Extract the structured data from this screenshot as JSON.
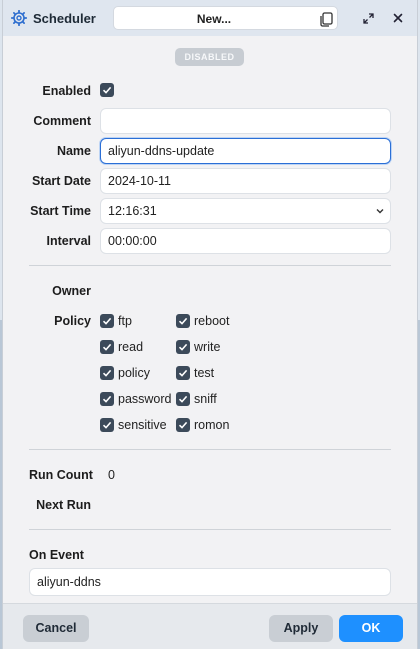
{
  "titlebar": {
    "title": "Scheduler",
    "field_value": "New...",
    "gear_icon": "gear-icon",
    "copy_icon": "copy-icon",
    "expand_icon": "expand-icon",
    "close_icon": "close-icon"
  },
  "status_badge": "DISABLED",
  "form": {
    "enabled_label": "Enabled",
    "enabled_checked": true,
    "comment_label": "Comment",
    "comment_value": "",
    "name_label": "Name",
    "name_value": "aliyun-ddns-update",
    "start_date_label": "Start Date",
    "start_date_value": "2024-10-11",
    "start_time_label": "Start Time",
    "start_time_value": "12:16:31",
    "interval_label": "Interval",
    "interval_value": "00:00:00"
  },
  "owner": {
    "label": "Owner",
    "value": ""
  },
  "policy": {
    "label": "Policy",
    "items": [
      {
        "label": "ftp",
        "checked": true
      },
      {
        "label": "reboot",
        "checked": true
      },
      {
        "label": "read",
        "checked": true
      },
      {
        "label": "write",
        "checked": true
      },
      {
        "label": "policy",
        "checked": true
      },
      {
        "label": "test",
        "checked": true
      },
      {
        "label": "password",
        "checked": true
      },
      {
        "label": "sniff",
        "checked": true
      },
      {
        "label": "sensitive",
        "checked": true
      },
      {
        "label": "romon",
        "checked": true
      }
    ]
  },
  "stats": {
    "run_count_label": "Run Count",
    "run_count_value": "0",
    "next_run_label": "Next Run",
    "next_run_value": ""
  },
  "on_event": {
    "label": "On Event",
    "value": "aliyun-ddns"
  },
  "footer": {
    "cancel_label": "Cancel",
    "apply_label": "Apply",
    "ok_label": "OK"
  },
  "colors": {
    "accent": "#1e90ff",
    "checkbox": "#3c4a5a",
    "focus": "#2b6fd6"
  }
}
